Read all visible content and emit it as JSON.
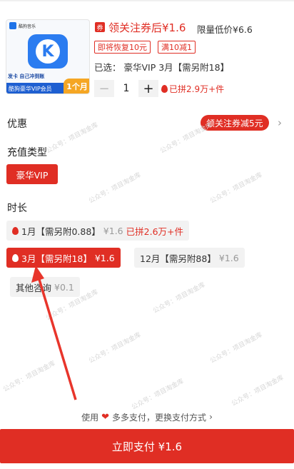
{
  "product": {
    "brand_text": "酷狗音乐",
    "promo_text": "发卡  自己冲到账",
    "bar_text": "酷狗豪华VIP会员",
    "month_tag": "1个月"
  },
  "price": {
    "coupon_icon": "券",
    "line": "领关注券后¥1.6",
    "original": "限量低价¥6.6"
  },
  "tags": [
    "即将恢复10元",
    "满10减1"
  ],
  "selected_text": "已选：  豪华VIP 3月【需另附18】",
  "stepper": {
    "minus": "−",
    "value": "1",
    "plus": "+"
  },
  "sold_text": "已拼2.9万+件",
  "sections": {
    "discount_label": "优惠",
    "discount_pill": "领关注券减5元",
    "recharge_label": "充值类型",
    "recharge_option": "豪华VIP",
    "duration_label": "时长"
  },
  "durations": [
    {
      "label": "1月【需另附0.88】",
      "price": "¥1.6",
      "extra": "已拼2.6万+件"
    },
    {
      "label": "3月【需另附18】",
      "price": "¥1.6"
    },
    {
      "label": "12月【需另附88】",
      "price": "¥1.6"
    },
    {
      "label": "其他咨询",
      "price": "¥0.1"
    }
  ],
  "payment": {
    "prefix": "使用",
    "method": "多多支付，更换支付方式",
    "chevron": "›",
    "button": "立即支付 ¥1.6"
  },
  "watermark": "公众号：项目淘金库",
  "colors": {
    "accent": "#e02e24",
    "brand_blue": "#2b7cf0",
    "tag_orange": "#f5a623"
  },
  "icons": [
    "coupon-icon",
    "flame-icon",
    "chevron-right-icon",
    "heart-icon",
    "app-logo-icon"
  ]
}
